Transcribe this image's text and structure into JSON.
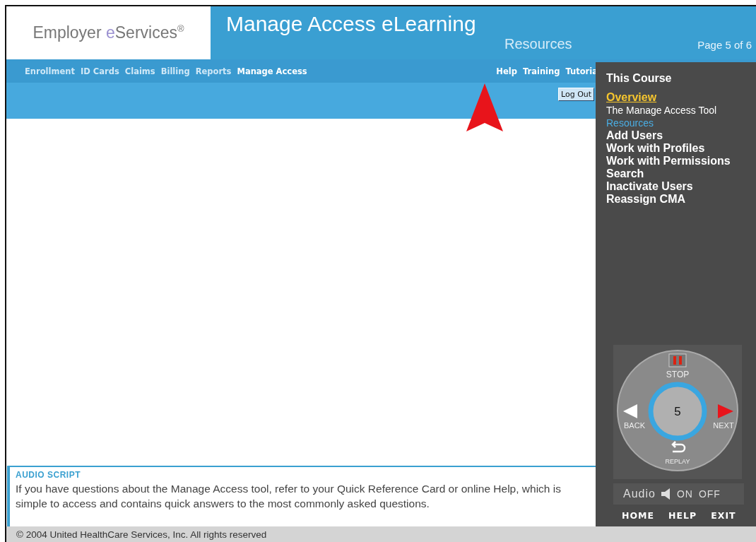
{
  "header": {
    "brand": {
      "lead": "Employer",
      "accent": "e",
      "rest": "Services",
      "mark": "®"
    },
    "title": "Manage Access eLearning",
    "subtitle": "Resources",
    "page_indicator": "Page 5 of 6"
  },
  "nav": {
    "items": [
      {
        "label": "Enrollment",
        "selected": false
      },
      {
        "label": "ID Cards",
        "selected": false
      },
      {
        "label": "Claims",
        "selected": false
      },
      {
        "label": "Billing",
        "selected": false
      },
      {
        "label": "Reports",
        "selected": false
      },
      {
        "label": "Manage Access",
        "selected": true
      }
    ],
    "utility_links": [
      "Help",
      "Training",
      "Tutoria"
    ]
  },
  "log_out": "Log Out",
  "course_menu": {
    "heading": "This Course",
    "items": [
      {
        "label": "Overview",
        "kind": "section",
        "selected": true,
        "current": false
      },
      {
        "label": "The Manage Access Tool",
        "kind": "subsection",
        "selected": false,
        "current": false
      },
      {
        "label": "Resources",
        "kind": "subsection",
        "selected": false,
        "current": true
      },
      {
        "label": "Add Users",
        "kind": "section",
        "selected": false,
        "current": false
      },
      {
        "label": "Work with Profiles",
        "kind": "section",
        "selected": false,
        "current": false
      },
      {
        "label": "Work with Permissions",
        "kind": "section",
        "selected": false,
        "current": false
      },
      {
        "label": "Search",
        "kind": "section",
        "selected": false,
        "current": false
      },
      {
        "label": "Inactivate Users",
        "kind": "section",
        "selected": false,
        "current": false
      },
      {
        "label": "Reassign CMA",
        "kind": "section",
        "selected": false,
        "current": false
      }
    ]
  },
  "player": {
    "stop": "STOP",
    "back": "BACK",
    "page": "5",
    "next": "NEXT",
    "replay": "REPLAY",
    "audio": "Audio",
    "on": "ON",
    "off": "OFF",
    "home": "HOME",
    "help": "HELP",
    "exit": "EXIT"
  },
  "audio_script": {
    "title": "AUDIO SCRIPT",
    "text": "If you have questions about the Manage Access tool, refer to your Quick Reference Card or online Help, which is simple to access and contains quick answers to the most commonly asked questions."
  },
  "footer": "© 2004 United HealthCare Services, Inc. All rights reserved"
}
